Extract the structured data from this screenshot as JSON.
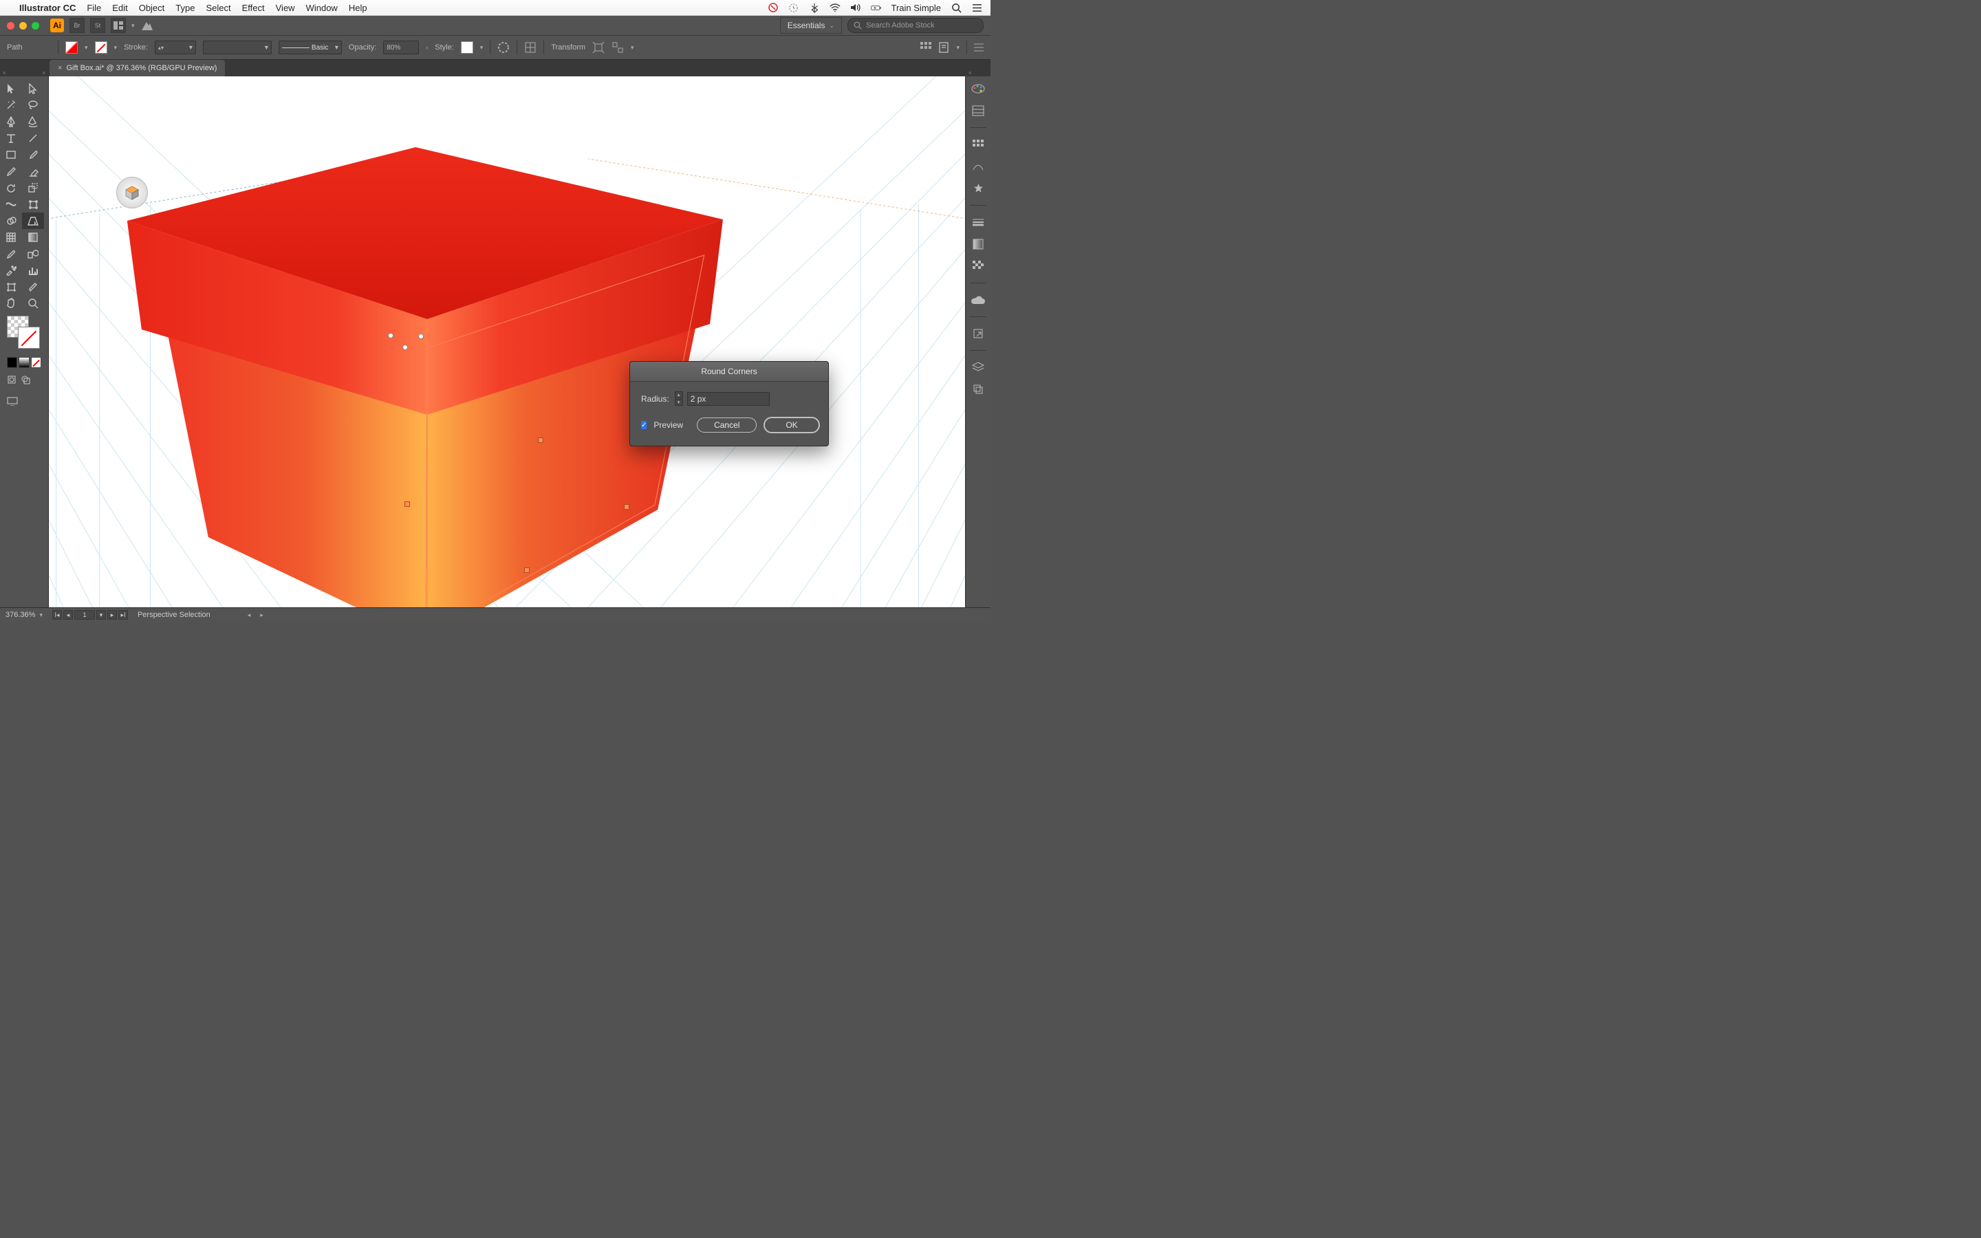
{
  "mac_menu": {
    "app_name": "Illustrator CC",
    "items": [
      "File",
      "Edit",
      "Object",
      "Type",
      "Select",
      "Effect",
      "View",
      "Window",
      "Help"
    ],
    "account": "Train Simple"
  },
  "app_bar": {
    "logo": "Ai",
    "button_br": "Br",
    "button_st": "St",
    "workspace_label": "Essentials",
    "search_placeholder": "Search Adobe Stock"
  },
  "control_bar": {
    "selection_label": "Path",
    "stroke_label": "Stroke:",
    "stroke_value": "",
    "style_label": "Basic",
    "opacity_label": "Opacity:",
    "opacity_value": "80%",
    "style_text": "Style:",
    "transform_label": "Transform"
  },
  "document": {
    "tab_label": "Gift Box.ai* @ 376.36% (RGB/GPU Preview)"
  },
  "dialog": {
    "title": "Round Corners",
    "radius_label": "Radius:",
    "radius_value": "2 px",
    "preview_label": "Preview",
    "cancel_label": "Cancel",
    "ok_label": "OK"
  },
  "status_bar": {
    "zoom": "376.36%",
    "artboard_num": "1",
    "tool_label": "Perspective Selection"
  },
  "left_tools": [
    [
      "selection",
      "direct-selection"
    ],
    [
      "magic-wand",
      "lasso"
    ],
    [
      "pen",
      "curvature"
    ],
    [
      "type",
      "line"
    ],
    [
      "rectangle",
      "paintbrush"
    ],
    [
      "pencil",
      "eraser"
    ],
    [
      "rotate",
      "scale"
    ],
    [
      "width",
      "free-transform"
    ],
    [
      "shape-builder",
      "perspective-selection"
    ],
    [
      "mesh",
      "gradient"
    ],
    [
      "eyedropper",
      "blend"
    ],
    [
      "symbol-sprayer",
      "column-graph"
    ],
    [
      "artboard",
      "slice"
    ],
    [
      "hand",
      "zoom"
    ]
  ],
  "right_panels": [
    "color",
    "swatches",
    "brushes",
    "symbols",
    "stroke",
    "graphic-styles",
    "appearance",
    "transparency",
    "cc-libraries",
    "export",
    "layers",
    "artboards"
  ]
}
